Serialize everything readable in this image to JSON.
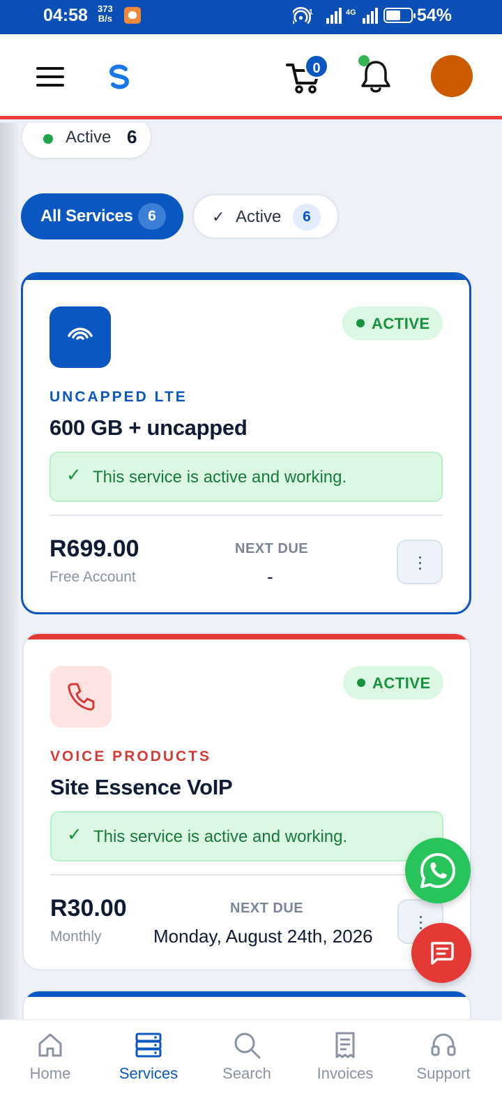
{
  "status_bar": {
    "time": "04:58",
    "speed_value": "373",
    "speed_unit": "B/s",
    "hotspot_count": "1",
    "network": "4G",
    "battery": "54%"
  },
  "header": {
    "cart_count": "0",
    "avatar_color": "#cc5a00",
    "brand_color": "#0a57c2",
    "accent_color": "#e53935"
  },
  "summary": {
    "active_label": "Active",
    "active_count": "6"
  },
  "filters": [
    {
      "label": "All Services",
      "count": "6",
      "selected": true
    },
    {
      "label": "Active",
      "count": "6",
      "selected": false
    }
  ],
  "services": [
    {
      "icon": "wifi-icon",
      "status": "ACTIVE",
      "category": "UNCAPPED LTE",
      "name": "600 GB + uncapped",
      "notice": "This service is active and working.",
      "price": "R699.00",
      "billing": "Free Account",
      "next_due_label": "NEXT DUE",
      "next_due_value": "-"
    },
    {
      "icon": "phone-icon",
      "status": "ACTIVE",
      "category": "VOICE PRODUCTS",
      "name": "Site Essence VoIP",
      "notice": "This service is active and working.",
      "price": "R30.00",
      "billing": "Monthly",
      "next_due_label": "NEXT DUE",
      "next_due_value": "Monday, August 24th, 2026"
    }
  ],
  "bottom_nav": [
    {
      "label": "Home",
      "icon": "home-icon",
      "active": false
    },
    {
      "label": "Services",
      "icon": "services-icon",
      "active": true
    },
    {
      "label": "Search",
      "icon": "search-icon",
      "active": false
    },
    {
      "label": "Invoices",
      "icon": "invoice-icon",
      "active": false
    },
    {
      "label": "Support",
      "icon": "headset-icon",
      "active": false
    }
  ]
}
